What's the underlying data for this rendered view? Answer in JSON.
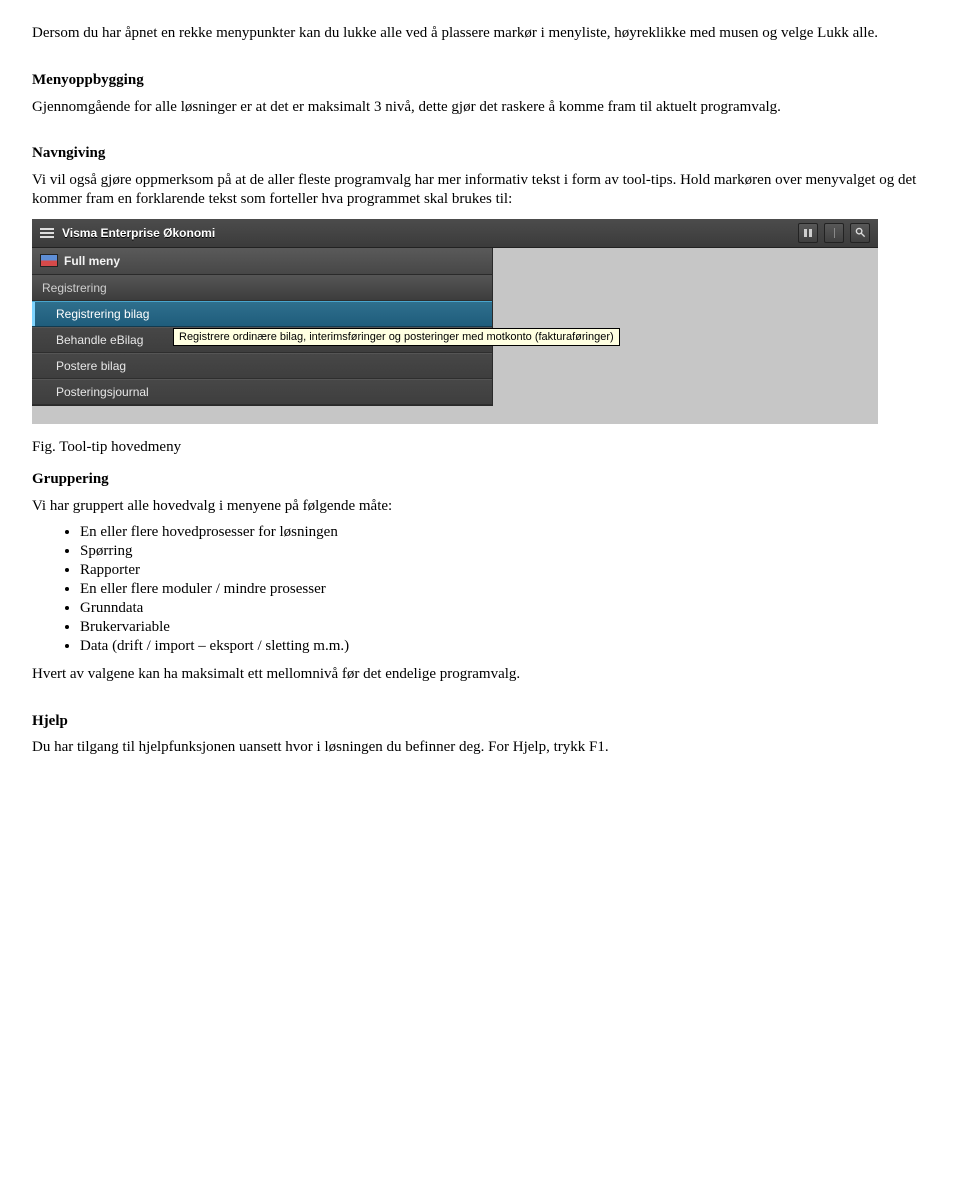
{
  "doc": {
    "p1": "Dersom du har åpnet en rekke menypunkter kan du lukke alle ved å plassere markør i menyliste, høyreklikke med musen og velge Lukk alle.",
    "h_menyoppbygging": "Menyoppbygging",
    "p2": "Gjennomgående for alle løsninger er at det er maksimalt 3 nivå, dette gjør det raskere å komme fram til aktuelt programvalg.",
    "h_navngiving": "Navngiving",
    "p3": "Vi vil også gjøre oppmerksom på at de aller fleste programvalg har mer informativ tekst i form av tool-tips. Hold markøren over menyvalget og det kommer fram en forklarende tekst som forteller hva programmet skal brukes til:",
    "fig_caption": "Fig. Tool-tip hovedmeny",
    "h_gruppering": "Gruppering",
    "p4": "Vi har gruppert alle hovedvalg i menyene på følgende måte:",
    "bullets": [
      "En eller flere hovedprosesser for løsningen",
      "Spørring",
      "Rapporter",
      "En eller flere moduler / mindre prosesser",
      "Grunndata",
      "Brukervariable",
      "Data (drift / import – eksport / sletting m.m.)"
    ],
    "p5": "Hvert av valgene kan ha maksimalt ett mellomnivå før det endelige programvalg.",
    "h_hjelp": "Hjelp",
    "p6": "Du har tilgang til hjelpfunksjonen uansett hvor i løsningen du befinner deg. For Hjelp, trykk F1."
  },
  "app": {
    "title": "Visma Enterprise Økonomi",
    "full_menu": "Full meny",
    "items": {
      "registrering": "Registrering",
      "registrering_bilag": "Registrering bilag",
      "behandle_ebilag": "Behandle eBilag",
      "postere_bilag": "Postere bilag",
      "posteringsjournal": "Posteringsjournal"
    },
    "tooltip": "Registrere ordinære bilag, interimsføringer og posteringer med motkonto (fakturaføringer)"
  }
}
